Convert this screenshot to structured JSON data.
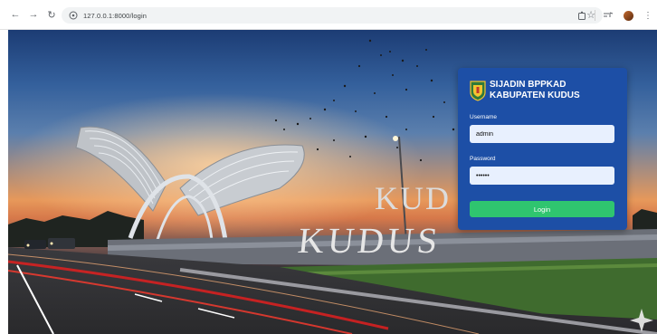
{
  "browser": {
    "url": "127.0.0.1:8000/login",
    "icons": [
      "back-arrow-icon",
      "forward-arrow-icon",
      "reload-icon",
      "site-info-icon",
      "bookmark-star-icon",
      "extensions-puzzle-icon",
      "media-controls-icon",
      "profile-avatar"
    ]
  },
  "background": {
    "monument_text_upper": "KUD",
    "monument_text_lower": "KUDUS"
  },
  "login_card": {
    "title_line1": "SIJADIN BPPKAD",
    "title_line2": "KABUPATEN KUDUS",
    "username_label": "Username",
    "username_value": "admin",
    "password_label": "Password",
    "password_value": "••••••",
    "login_button": "Login",
    "colors": {
      "card": "#1d4fa6",
      "button": "#2fc56f",
      "input": "#e8f0fe"
    }
  }
}
